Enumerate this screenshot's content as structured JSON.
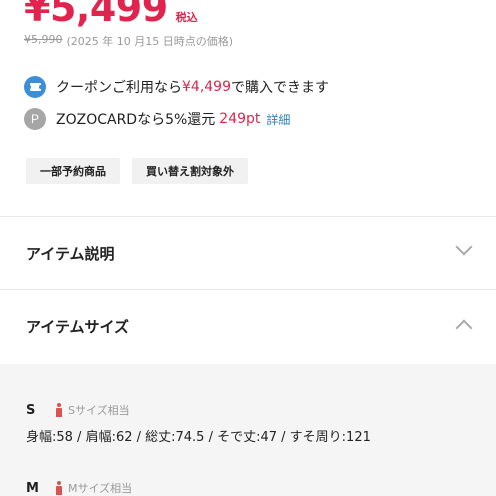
{
  "price": {
    "value": "¥5,499",
    "tax_label": "税込"
  },
  "old_price": {
    "value": "¥5,990",
    "note": "(2025 年 10 月15 日時点の価格)"
  },
  "coupon": {
    "prefix": "クーポンご利用なら",
    "amount": "¥4,499",
    "suffix": "で購入できます"
  },
  "point": {
    "icon_letter": "P",
    "text": "ZOZOCARDなら5%還元",
    "points": "249pt",
    "detail_link": "詳細"
  },
  "tags": [
    "一部予約商品",
    "買い替え割対象外"
  ],
  "sections": {
    "description": {
      "title": "アイテム説明"
    },
    "size": {
      "title": "アイテムサイズ"
    }
  },
  "sizes": [
    {
      "label": "S",
      "equiv": "Sサイズ相当",
      "measurements": "身幅:58 / 肩幅:62 / 総丈:74.5 / そで丈:47 / すそ周り:121"
    },
    {
      "label": "M",
      "equiv": "Mサイズ相当",
      "measurements": ""
    }
  ],
  "colors": {
    "accent_red": "#e0244d",
    "link_blue": "#2b82c8",
    "coupon_blue": "#3b8fd8"
  }
}
